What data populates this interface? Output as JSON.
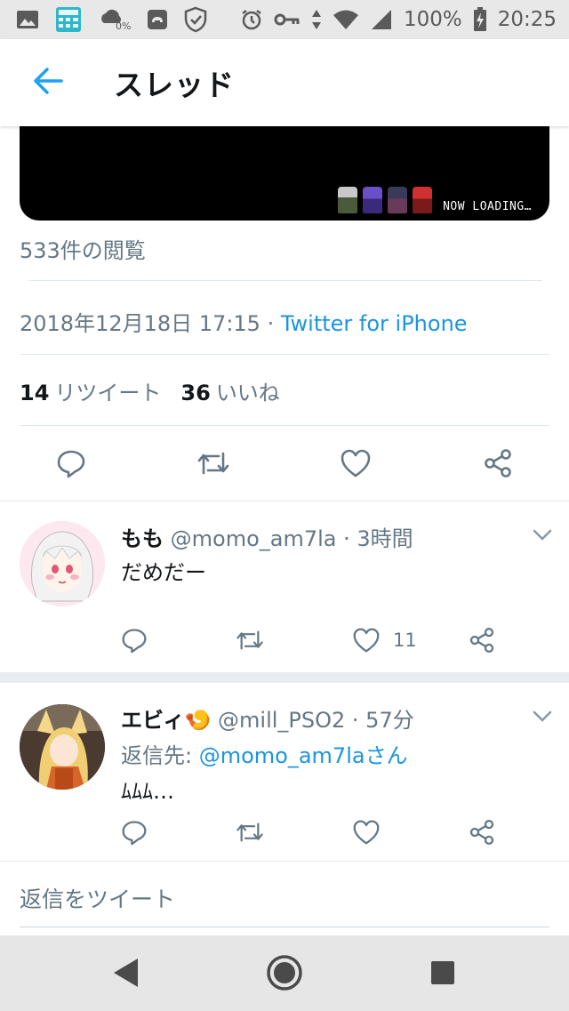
{
  "status_bar": {
    "battery_percent": "100%",
    "time": "20:25",
    "data_saver_label": "0%",
    "icons": [
      "gallery-icon",
      "calculator-icon",
      "cloud-sync-icon",
      "phone-app-icon",
      "shield-check-icon",
      "alarm-icon",
      "vpn-key-icon",
      "data-arrows-icon",
      "wifi-icon",
      "signal-icon",
      "battery-charging-icon"
    ]
  },
  "header": {
    "title": "スレッド",
    "back_icon": "arrow-left-icon"
  },
  "media": {
    "loading_text": "NOW LOADING…"
  },
  "tweet": {
    "views": "533件の閲覧",
    "date": "2018年12月18日 17:15 · ",
    "via": "Twitter for iPhone",
    "retweet_count": "14",
    "retweet_label": "リツイート",
    "like_count": "36",
    "like_label": "いいね"
  },
  "replies": [
    {
      "name": "もも",
      "meta": " @momo_am7la · 3時間",
      "text": "だめだー",
      "like_count": "11"
    },
    {
      "name": "エビィ🍤",
      "meta": " @mill_PSO2 · 57分",
      "reply_prefix": "返信先: ",
      "reply_target": "@momo_am7laさん",
      "text": "ﾑﾑﾑ…"
    }
  ],
  "compose": {
    "placeholder": "返信をツイート"
  },
  "colors": {
    "accent": "#1da1f2",
    "link": "#1b95e0",
    "secondary_text": "#657786",
    "primary_text": "#14171a"
  }
}
